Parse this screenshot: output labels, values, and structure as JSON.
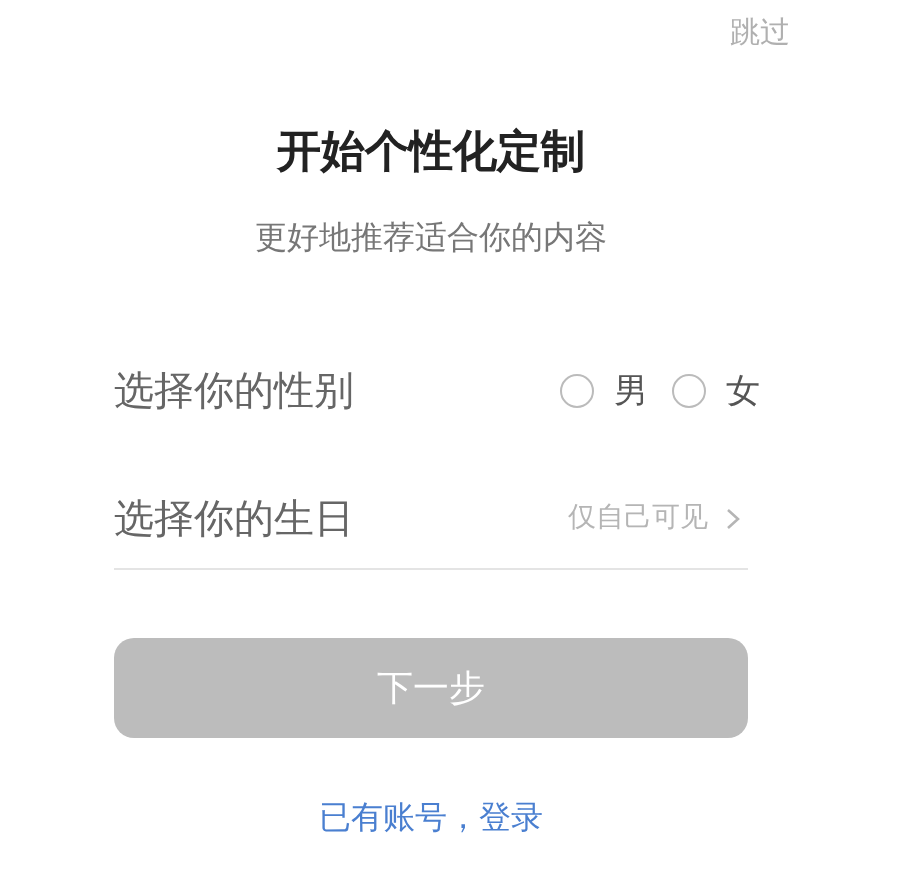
{
  "skip": "跳过",
  "title": "开始个性化定制",
  "subtitle": "更好地推荐适合你的内容",
  "gender": {
    "label": "选择你的性别",
    "options": [
      {
        "label": "男",
        "selected": false
      },
      {
        "label": "女",
        "selected": false
      }
    ]
  },
  "birthday": {
    "label": "选择你的生日",
    "hint": "仅自己可见"
  },
  "next_button": {
    "label": "下一步",
    "disabled": true
  },
  "login_link": "已有账号，登录"
}
